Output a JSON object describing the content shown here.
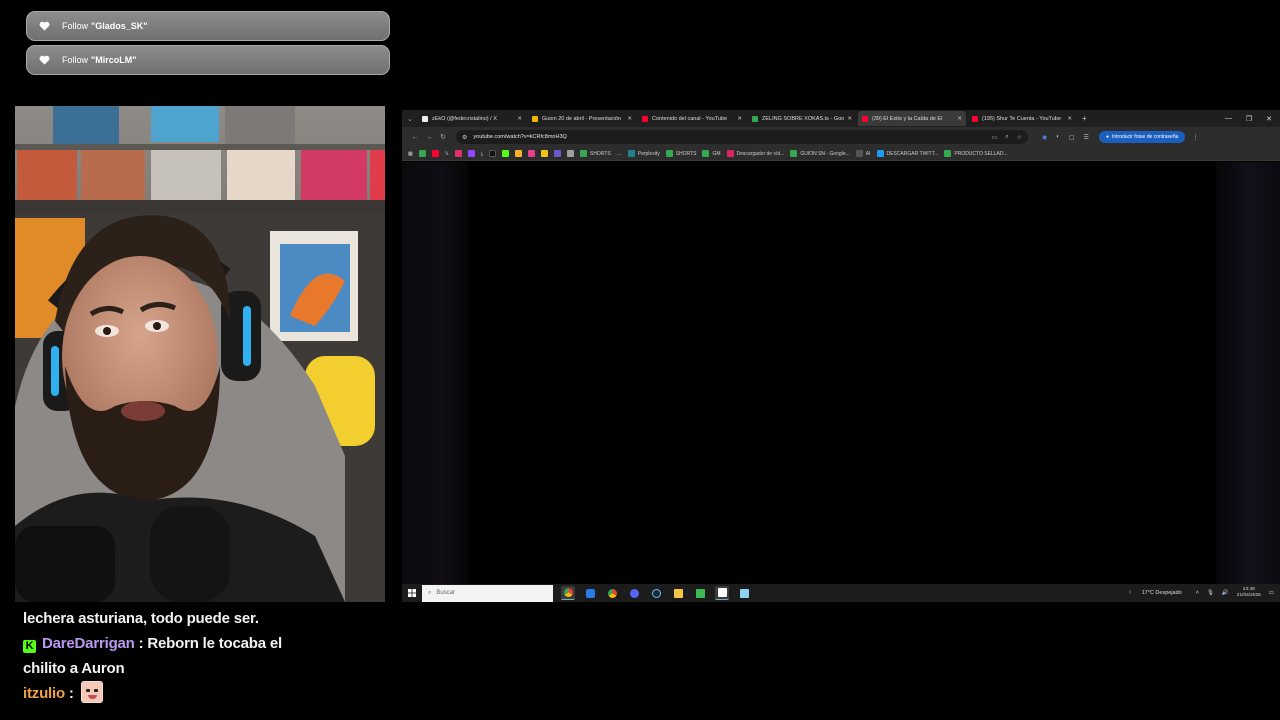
{
  "alerts": [
    {
      "prefix": "Follow",
      "user": "\"Glados_SK\""
    },
    {
      "prefix": "Follow",
      "user": "\"MircoLM\""
    }
  ],
  "chat": {
    "line1_text": "lechera asturiana, todo puede ser.",
    "line2_badge": "K",
    "line2_user": "DareDarrigan",
    "line2_sep": ":",
    "line2_text_a": "Reborn le tocaba el",
    "line2_text_b": "chilito a Auron",
    "line3_user": "itzulio",
    "line3_sep": ":"
  },
  "browser": {
    "tabs": [
      {
        "label": "zEkO (@fedecristalino) / X",
        "color": "#222222",
        "active": false
      },
      {
        "label": "Guion 20 de abril - Presentación",
        "color": "#f4b400",
        "active": false
      },
      {
        "label": "Contenido del canal - YouTube",
        "color": "#ff0033",
        "active": false
      },
      {
        "label": "ZELING SOBRE XOKAS.ts - Goo",
        "color": "#34a853",
        "active": false
      },
      {
        "label": "(39) El Éxito y la Caída de El",
        "color": "#ff0033",
        "active": true
      },
      {
        "label": "(195) Shur Te Cuenta - YouTube",
        "color": "#ff0033",
        "active": false
      }
    ],
    "new_tab": "+",
    "url": "youtube.com/watch?v=kCRfc8mnH3Q",
    "password_button": "Introducir frase de contraseña",
    "bookmarks": [
      {
        "label": "SHORTS",
        "color": "#34a853"
      },
      {
        "label": "Perplexity",
        "color": "#20808d"
      },
      {
        "label": "SHORTS",
        "color": "#34a853"
      },
      {
        "label": "GM",
        "color": "#34a853"
      },
      {
        "label": "Descargador de víd...",
        "color": "#e0245e"
      },
      {
        "label": "GUION SN - Google...",
        "color": "#34a853"
      },
      {
        "label": "AI",
        "color": "#555555"
      },
      {
        "label": "DESCARGAR TWITT...",
        "color": "#1d9bf0"
      },
      {
        "label": "PRODUCTO SELLAD...",
        "color": "#34a853"
      }
    ]
  },
  "taskbar": {
    "search_placeholder": "Buscar",
    "weather": "17°C  Despejado",
    "time": "23:48",
    "date": "21/04/2026"
  },
  "colors": {
    "alert_bg": "#7f7f7f",
    "chat_user_1": "#b998f0",
    "chat_user_2": "#f0a14a",
    "kick_green": "#53fc18",
    "pwd_blue": "#1b5fbf"
  }
}
